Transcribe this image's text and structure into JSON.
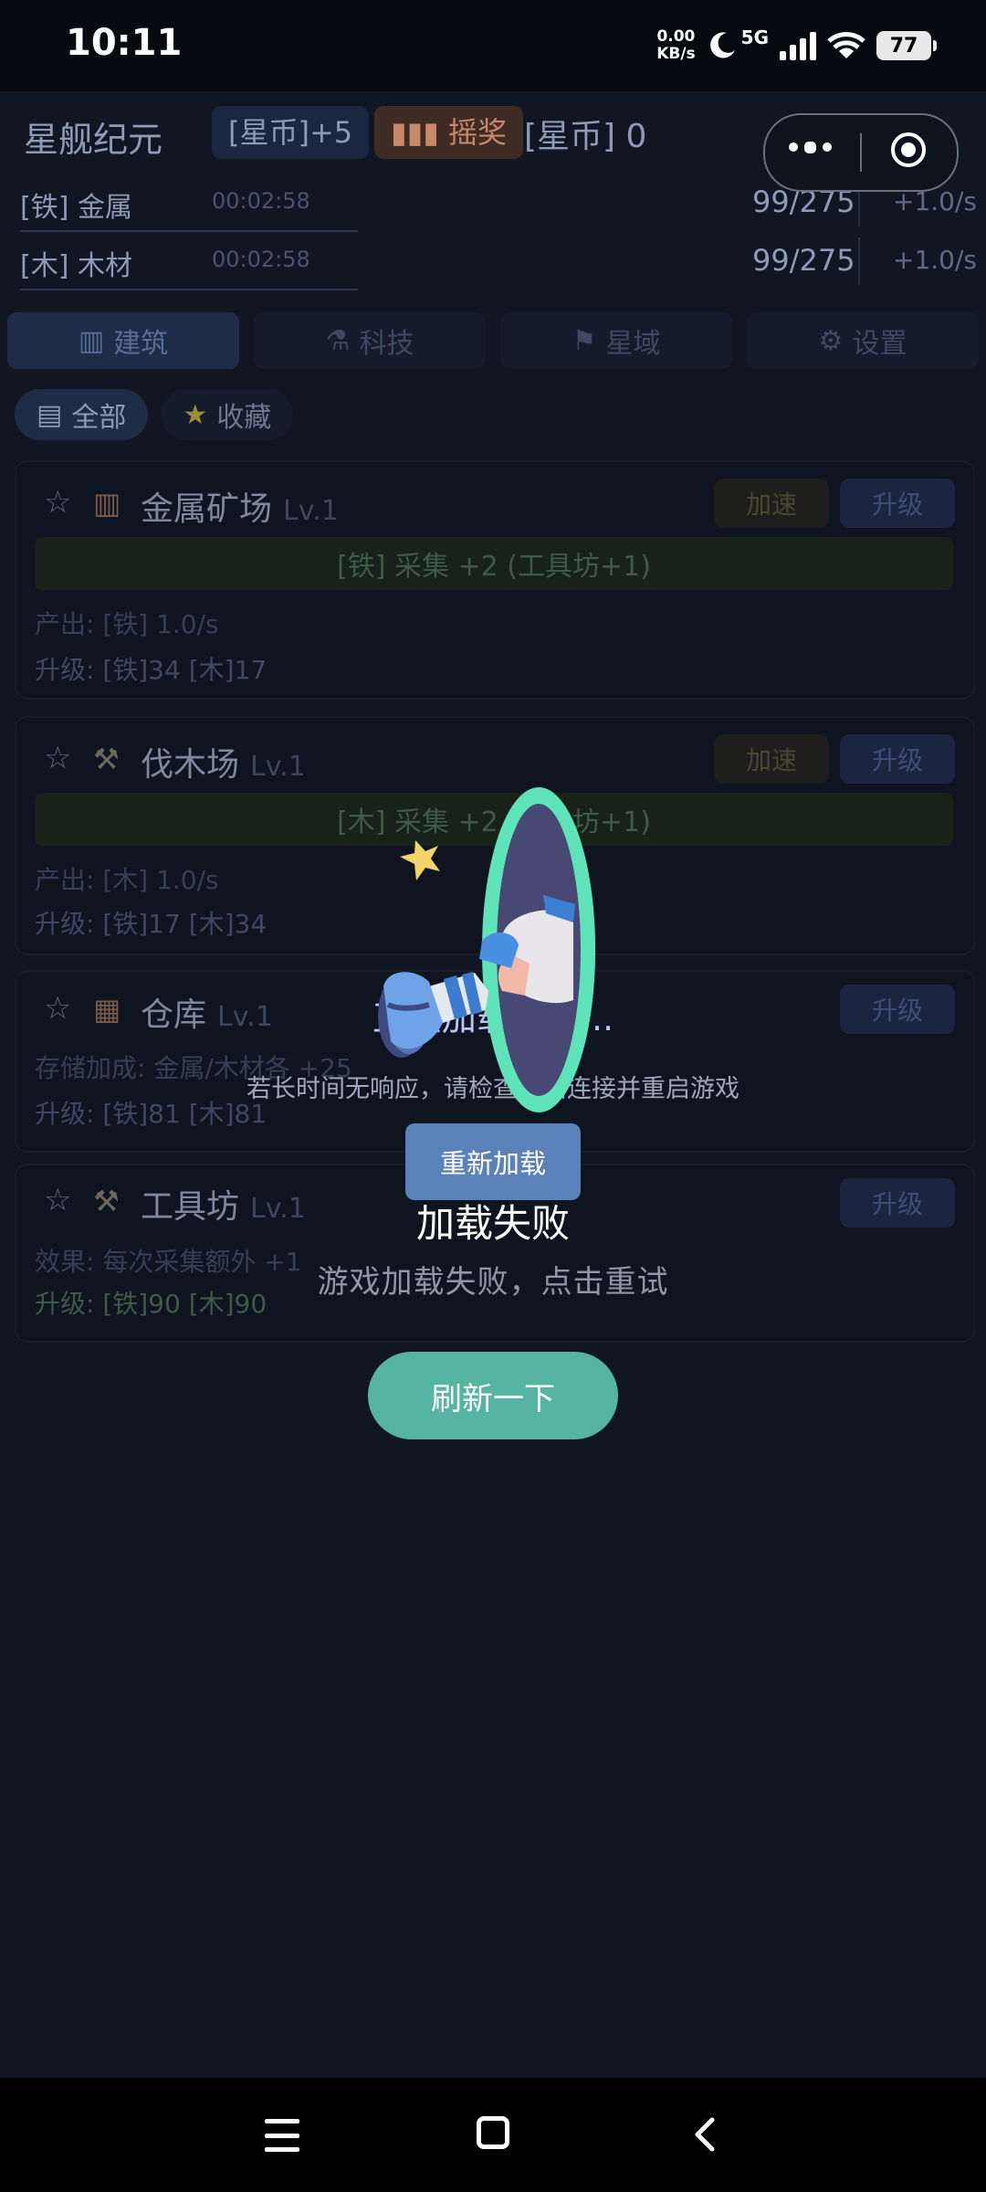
{
  "status_bar": {
    "time": "10:11",
    "net_speed": "0.00",
    "net_unit": "KB/s",
    "network": "5G",
    "battery": "77"
  },
  "game": {
    "title": "星舰纪元",
    "coin_chip": "[星币]+5",
    "lottery_chip": "▮▮▮ 摇奖",
    "coin_balance": "[星币] 0",
    "resources": [
      {
        "name": "[铁] 金属",
        "timer": "00:02:58",
        "count": "99/275",
        "rate": "+1.0/s"
      },
      {
        "name": "[木] 木材",
        "timer": "00:02:58",
        "count": "99/275",
        "rate": "+1.0/s"
      }
    ],
    "tabs": [
      {
        "icon": "▥",
        "label": "建筑"
      },
      {
        "icon": "⚗",
        "label": "科技"
      },
      {
        "icon": "⚑",
        "label": "星域"
      },
      {
        "icon": "⚙",
        "label": "设置"
      }
    ],
    "filters": [
      {
        "icon": "▤",
        "label": "全部"
      },
      {
        "icon": "★",
        "label": "收藏"
      }
    ],
    "buildings": [
      {
        "star": "☆",
        "icon": "▥",
        "name": "金属矿场",
        "level": "Lv.1",
        "speed": "加速",
        "upgrade": "升级",
        "bar": "[铁] 采集 +2 (工具坊+1)",
        "line1": "产出: [铁] 1.0/s",
        "line2": "升级: [铁]34 [木]17"
      },
      {
        "star": "☆",
        "icon": "⚒",
        "name": "伐木场",
        "level": "Lv.1",
        "speed": "加速",
        "upgrade": "升级",
        "bar": "[木] 采集 +2 (工具坊+1)",
        "line1": "产出: [木] 1.0/s",
        "line2": "升级: [铁]17 [木]34"
      },
      {
        "star": "☆",
        "icon": "▦",
        "name": "仓库",
        "level": "Lv.1",
        "upgrade": "升级",
        "line1": "存储加成: 金属/木材各 +25",
        "line2": "升级: [铁]81 [木]81"
      },
      {
        "star": "☆",
        "icon": "⚒",
        "name": "工具坊",
        "level": "Lv.1",
        "upgrade": "升级",
        "line1": "效果: 每次采集额外 +1",
        "line2": "升级: [铁]90 [木]90"
      }
    ]
  },
  "overlay": {
    "loading_text": "正在加载存档...",
    "tip": "若长时间无响应，请检查网络连接并重启游戏",
    "reload_button": "重新加载",
    "error_title": "加载失败",
    "error_desc": "游戏加载失败，点击重试",
    "refresh_button": "刷新一下"
  },
  "colors": {
    "portal_ring": "#5fe3b9",
    "refresh_button": "#55b5a2",
    "reload_button": "#5b82b8"
  }
}
